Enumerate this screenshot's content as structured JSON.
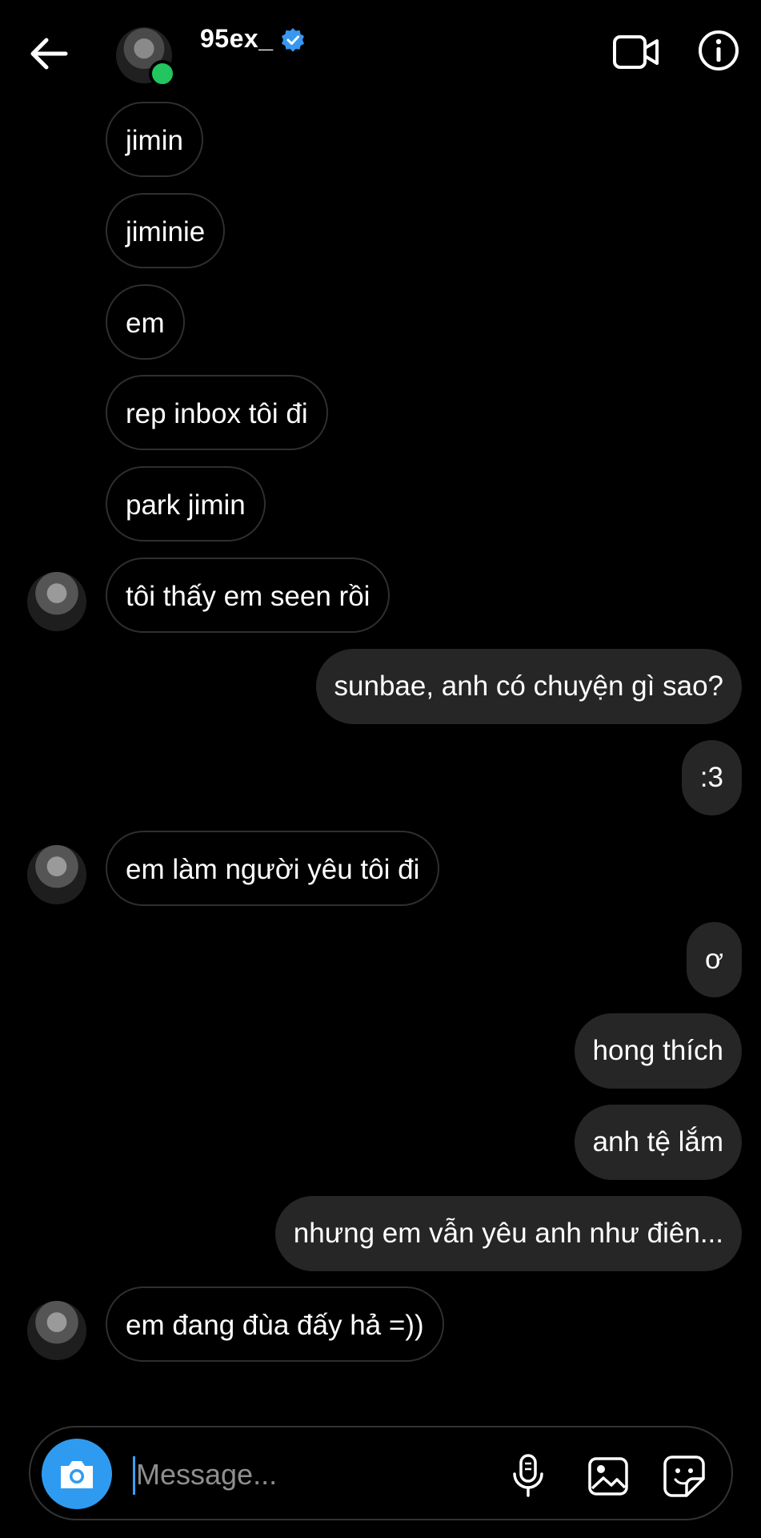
{
  "header": {
    "username": "95ex_",
    "verified": true,
    "online": true
  },
  "messages": [
    {
      "dir": "in",
      "text": "jimin",
      "avatar": false
    },
    {
      "dir": "in",
      "text": "jiminie",
      "avatar": false
    },
    {
      "dir": "in",
      "text": "em",
      "avatar": false
    },
    {
      "dir": "in",
      "text": "rep inbox tôi đi",
      "avatar": false
    },
    {
      "dir": "in",
      "text": "park jimin",
      "avatar": false
    },
    {
      "dir": "in",
      "text": "tôi thấy em seen rồi",
      "avatar": true
    },
    {
      "dir": "out",
      "text": "sunbae, anh có chuyện gì sao?",
      "avatar": false
    },
    {
      "dir": "out",
      "text": ":3",
      "avatar": false
    },
    {
      "dir": "in",
      "text": "em làm người yêu tôi đi",
      "avatar": true
    },
    {
      "dir": "out",
      "text": "ơ",
      "avatar": false
    },
    {
      "dir": "out",
      "text": "hong thích",
      "avatar": false
    },
    {
      "dir": "out",
      "text": "anh tệ lắm",
      "avatar": false
    },
    {
      "dir": "out",
      "text": "nhưng em vẫn yêu anh như điên...",
      "avatar": false
    },
    {
      "dir": "in",
      "text": "em đang đùa đấy hả =))",
      "avatar": true
    }
  ],
  "composer": {
    "placeholder": "Message...",
    "value": ""
  },
  "colors": {
    "background": "#000000",
    "incoming_border": "#2f2f2f",
    "outgoing_bubble": "#262626",
    "accent": "#2f9bf0",
    "online": "#22c55e",
    "verified": "#3897f0"
  },
  "icons": {
    "back": "arrow-left-icon",
    "verified": "verified-badge-icon",
    "video": "video-call-icon",
    "info": "info-icon",
    "camera": "camera-icon",
    "mic": "microphone-icon",
    "gallery": "gallery-icon",
    "sticker": "sticker-icon"
  }
}
